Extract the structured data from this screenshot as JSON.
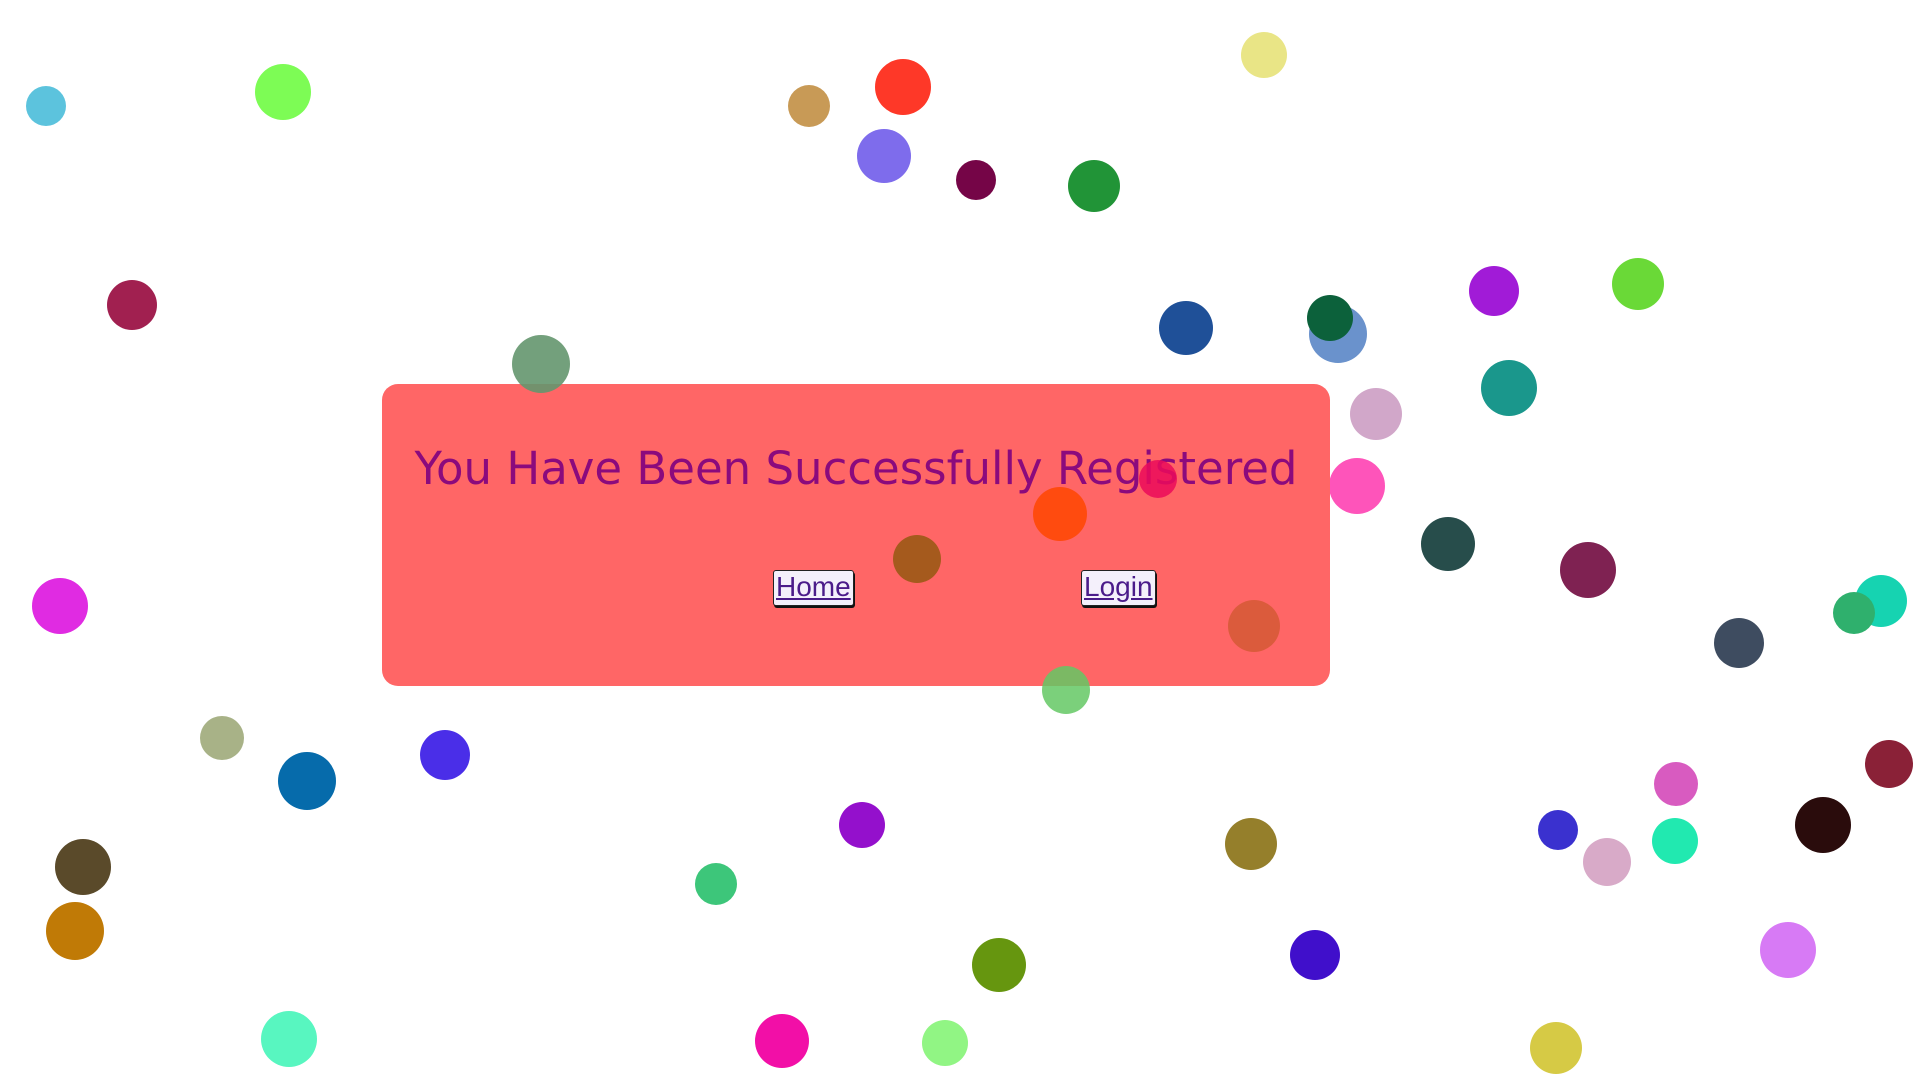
{
  "page": {
    "title": "You Have Been Successfully Registered",
    "links": {
      "home": "Home",
      "login": "Login"
    }
  },
  "colors": {
    "background": "#ffffff",
    "card": "#ff6666",
    "title": "#8b0a7d",
    "link": "#4b1c8a"
  }
}
